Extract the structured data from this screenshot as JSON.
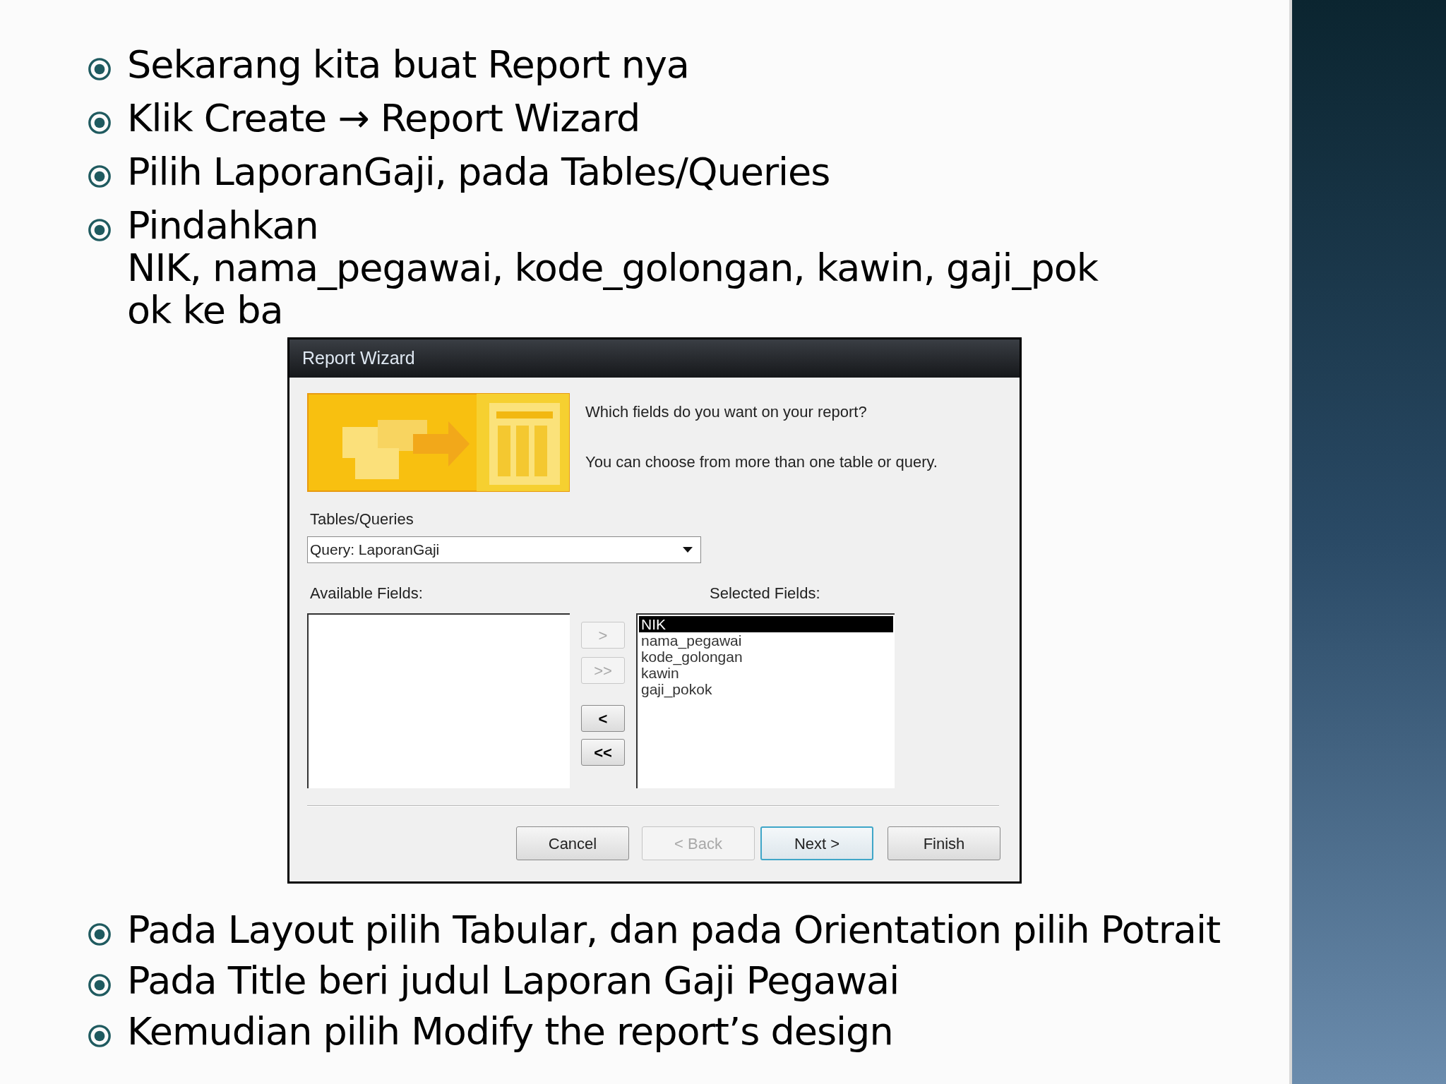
{
  "bullets_top": [
    {
      "lines": [
        "Sekarang kita buat Report nya"
      ]
    },
    {
      "lines": [
        "Klik Create → Report Wizard"
      ]
    },
    {
      "lines": [
        "Pilih LaporanGaji, pada Tables/Queries"
      ]
    },
    {
      "lines": [
        "Pindahkan",
        "NIK, nama_pegawai, kode_golongan, kawin, gaji_pok",
        "ok ke ba"
      ]
    }
  ],
  "dialog": {
    "title": "Report Wizard",
    "prompt": "Which fields do you want on your report?",
    "hint": "You can choose from more than one table or query.",
    "tables_label": "Tables/Queries",
    "tables_value": "Query: LaporanGaji",
    "available_label": "Available Fields:",
    "selected_label": "Selected Fields:",
    "move_buttons": [
      {
        "label": ">",
        "disabled": true
      },
      {
        "label": ">>",
        "disabled": true
      },
      {
        "label": "<",
        "disabled": false
      },
      {
        "label": "<<",
        "disabled": false
      }
    ],
    "selected_fields": [
      {
        "label": "NIK",
        "selected": true
      },
      {
        "label": "nama_pegawai",
        "selected": false
      },
      {
        "label": "kode_golongan",
        "selected": false
      },
      {
        "label": "kawin",
        "selected": false
      },
      {
        "label": "gaji_pokok",
        "selected": false
      }
    ],
    "buttons": [
      {
        "label": "Cancel",
        "disabled": false,
        "default": false
      },
      {
        "label": "< Back",
        "disabled": true,
        "default": false
      },
      {
        "label": "Next >",
        "disabled": false,
        "default": true
      },
      {
        "label": "Finish",
        "disabled": false,
        "default": false
      }
    ]
  },
  "bullets_bottom": [
    {
      "lines": [
        "Pada Layout pilih Tabular, dan pada Orientation pilih Potrait"
      ]
    },
    {
      "lines": [
        "Pada Title beri judul Laporan Gaji Pegawai"
      ]
    },
    {
      "lines": [
        "Kemudian pilih Modify the report’s design"
      ]
    }
  ]
}
